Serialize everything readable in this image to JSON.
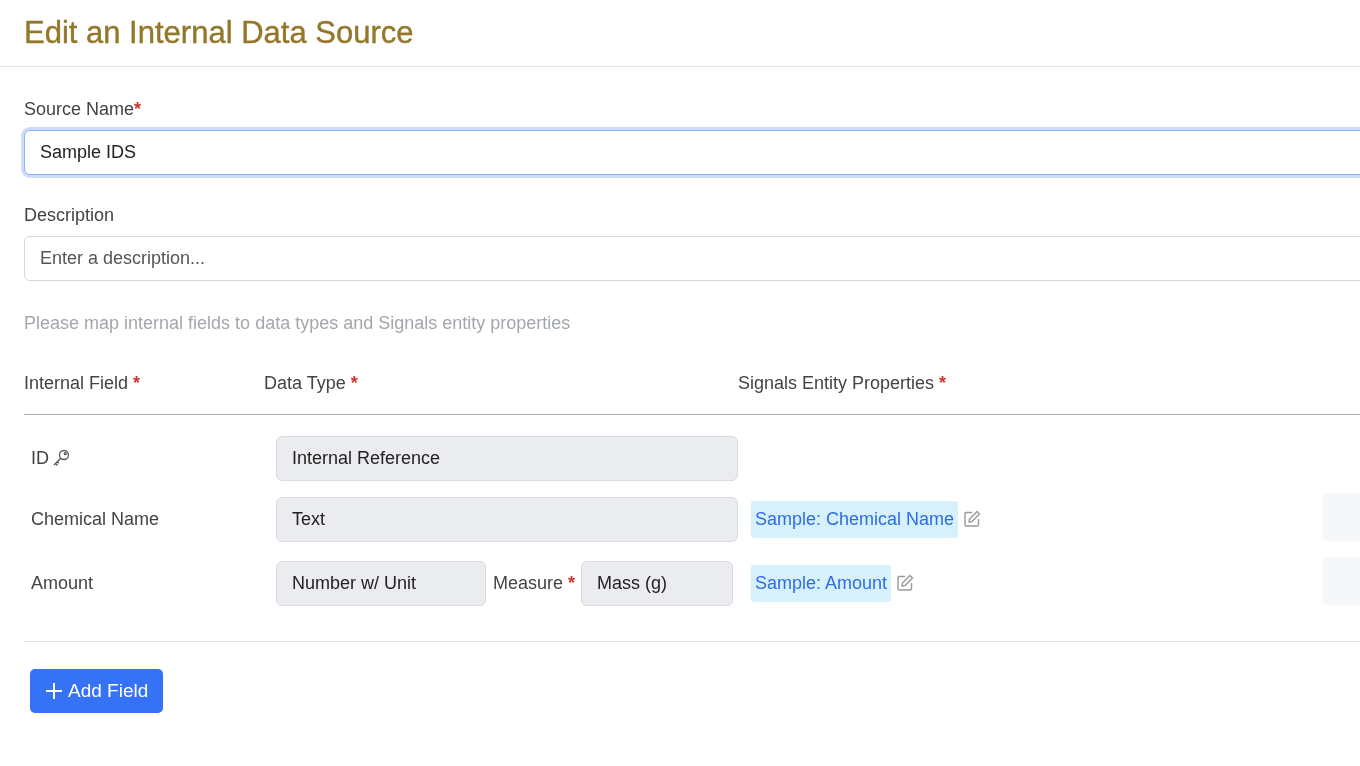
{
  "title": "Edit an Internal Data Source",
  "source_name": {
    "label": "Source Name",
    "required_mark": "*",
    "value": "Sample IDS",
    "focused": true
  },
  "description": {
    "label": "Description",
    "placeholder": "Enter a description..."
  },
  "hint": "Please map internal fields to data types and Signals entity properties",
  "columns": [
    {
      "label": "Internal Field",
      "required_mark": "*"
    },
    {
      "label": "Data Type",
      "required_mark": "*"
    },
    {
      "label": "Signals Entity Properties",
      "required_mark": "*"
    }
  ],
  "rows": [
    {
      "name": "ID",
      "primary_key": true,
      "data_type": "Internal Reference"
    },
    {
      "name": "Chemical Name",
      "primary_key": false,
      "data_type": "Text",
      "property": "Sample: Chemical Name"
    },
    {
      "name": "Amount",
      "primary_key": false,
      "data_type": "Number w/ Unit",
      "measure": {
        "label": "Measure",
        "required_mark": "*",
        "value": "Mass (g)"
      },
      "property": "Sample: Amount"
    }
  ],
  "add_button": {
    "label": "Add Field"
  }
}
